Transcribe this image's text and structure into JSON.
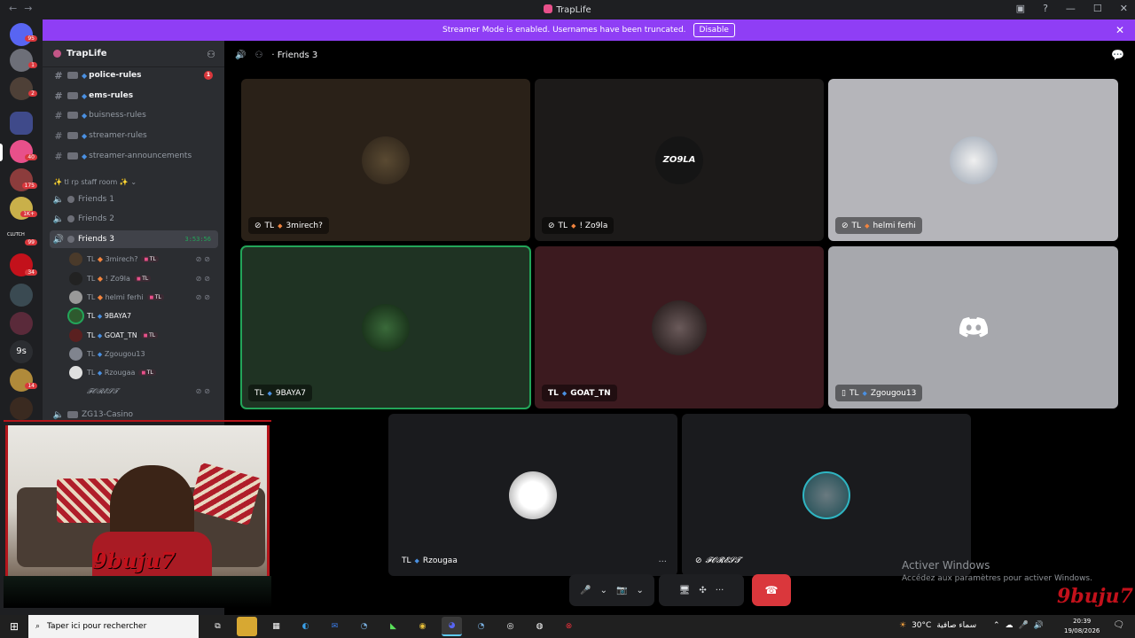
{
  "window": {
    "title": "TrapLife",
    "nav": "←→",
    "controls": [
      "▣",
      "?",
      "—",
      "☐",
      "✕"
    ]
  },
  "streamer_bar": {
    "message": "Streamer Mode is enabled. Usernames have been truncated.",
    "disable_label": "Disable",
    "close": "✕"
  },
  "rail": {
    "badges": [
      "95",
      "1",
      "2",
      "40",
      "175",
      "1K+",
      "99",
      "34",
      "14"
    ],
    "folder_label": "9s",
    "small_label": "CLUTCH"
  },
  "sidebar": {
    "guild_name": "TrapLife",
    "channels": [
      {
        "label": "police-rules",
        "unread": true,
        "mentions": "1"
      },
      {
        "label": "ems-rules",
        "unread": true
      },
      {
        "label": "buisness-rules",
        "unread": false
      },
      {
        "label": "streamer-rules",
        "unread": false
      },
      {
        "label": "streamer-announcements",
        "unread": false
      }
    ],
    "category": "✨ tl rp staff room ✨",
    "voice_channels": [
      {
        "label": "Friends 1"
      },
      {
        "label": "Friends 2"
      },
      {
        "label": "Friends 3",
        "timer": "3:53:56"
      }
    ],
    "voice_users": [
      {
        "prefix": "TL",
        "name": "3mirech?",
        "tag": "TL"
      },
      {
        "prefix": "TL",
        "name": "! Zo9la",
        "tag": "TL"
      },
      {
        "prefix": "TL",
        "name": "helmi ferhi",
        "tag": "TL"
      },
      {
        "prefix": "TL",
        "name": "9BAYA7"
      },
      {
        "prefix": "TL",
        "name": "GOAT_TN",
        "tag": "TL"
      },
      {
        "prefix": "TL",
        "name": "Zgougou13"
      },
      {
        "prefix": "TL",
        "name": "Rzougaa",
        "tag": "TL"
      },
      {
        "prefix": "",
        "name": "𝓕𝓞𝓡𝓔𝓢𝓣"
      }
    ],
    "next_channel": "ZG13-Casino"
  },
  "main": {
    "channel_name": "Friends 3",
    "tiles": [
      {
        "prefix": "TL",
        "name": "3mirech?",
        "bg": "#2a2118"
      },
      {
        "prefix": "TL",
        "name": "! Zo9la",
        "bg": "#1c1a19",
        "avatar_text": "ZO9LA"
      },
      {
        "prefix": "TL",
        "name": "helmi ferhi",
        "bg": "#b5b5ba"
      },
      {
        "prefix": "TL",
        "name": "9BAYA7",
        "bg": "#1f3323"
      },
      {
        "prefix": "TL",
        "name": "GOAT_TN",
        "bg": "#3c1a1f"
      },
      {
        "prefix": "TL",
        "name": "Zgougou13",
        "bg": "#a7a8ad"
      },
      {
        "prefix": "TL",
        "name": "Rzougaa",
        "bg": "#1a1b1e"
      },
      {
        "prefix": "",
        "name": "𝓕𝓞𝓡𝓔𝓢𝓣",
        "bg": "#1a1b1e"
      }
    ],
    "more": "···"
  },
  "controls": {
    "mic": "🎤",
    "camera": "📷",
    "share": "🖥",
    "activities": "✣",
    "more": "···",
    "hangup": "☎"
  },
  "activation": {
    "line1": "Activer Windows",
    "line2": "Accédez aux paramètres pour activer Windows."
  },
  "watermark": "9buju7",
  "taskbar": {
    "search_placeholder": "Taper ici pour rechercher",
    "weather_temp": "30°C",
    "weather_desc": "سماء صافية",
    "time": "20:39",
    "date": "19/08/2026"
  },
  "colors": {
    "accent": "#8f3ef5",
    "speaking": "#23a559",
    "danger": "#da373c"
  }
}
